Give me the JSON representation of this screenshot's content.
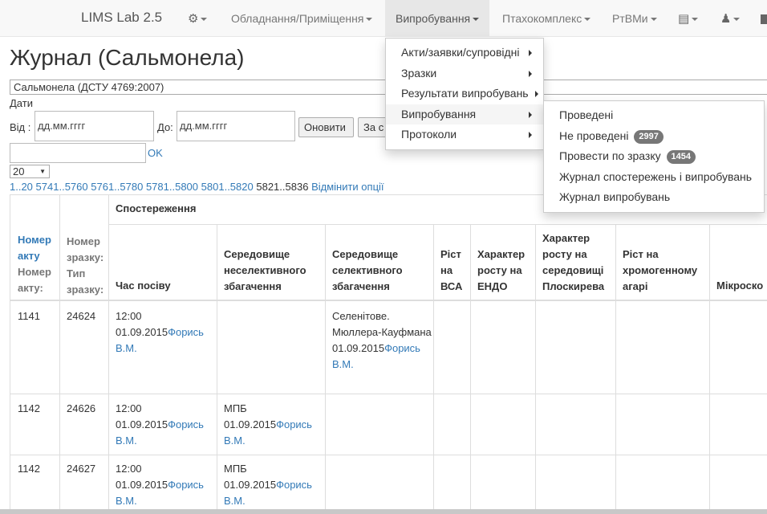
{
  "navbar": {
    "brand": "LIMS Lab 2.5",
    "settings_icon": "gear-icon",
    "menus": [
      {
        "label": "Обладнання/Приміщення"
      },
      {
        "label": "Випробування"
      },
      {
        "label": "Птахокомплекс"
      },
      {
        "label": "РтВМи"
      }
    ],
    "list_icon": "list-icon",
    "user_icon": "user-icon"
  },
  "page": {
    "title": "Журнал (Сальмонела)",
    "test_select": "Сальмонела (ДСТУ 4769:2007)",
    "dates_label": "Дати",
    "from_label": "Від :",
    "from_placeholder": "дд.мм.гггг",
    "to_label": "До:",
    "to_placeholder": "дд.мм.гггг",
    "refresh_button": "Оновити",
    "second_button": "За с",
    "ok_link": "OK",
    "per_page": "20"
  },
  "pager": {
    "links": [
      "1..20",
      "5741..5760",
      "5761..5780",
      "5781..5800",
      "5801..5820"
    ],
    "current": "5821..5836",
    "cancel_options": "Відмінити опції"
  },
  "table": {
    "col_act_link": "Номер акту",
    "col_act_sub": "Номер акту:",
    "col_sample": "Номер зразку:",
    "col_sample_type": "Тип зразку:",
    "group_header": "Спостереження",
    "columns": [
      "Час посіву",
      "Середовище неселективного збагачення",
      "Середовище селективного збагачення",
      "Ріст на ВСА",
      "Характер росту на ЕНДО",
      "Характер росту на середовищі Плоскирева",
      "Ріст на хромогенному агарі",
      "Мікроско"
    ],
    "rows": [
      {
        "act": "1141",
        "sample": "24624",
        "sow_time": "12:00",
        "sow_date": "01.09.2015",
        "sow_person": "Форись В.М.",
        "nonselective": "",
        "nonselective_date": "",
        "nonselective_person": "",
        "selective": "Селенітове. Мюллера-Кауфмана",
        "selective_date": "01.09.2015",
        "selective_person": "Форись В.М."
      },
      {
        "act": "1142",
        "sample": "24626",
        "sow_time": "12:00",
        "sow_date": "01.09.2015",
        "sow_person": "Форись В.М.",
        "nonselective": "МПБ",
        "nonselective_date": "01.09.2015",
        "nonselective_person": "Форись В.М.",
        "selective": "",
        "selective_date": "",
        "selective_person": ""
      },
      {
        "act": "1142",
        "sample": "24627",
        "sow_time": "12:00",
        "sow_date": "01.09.2015",
        "sow_person": "Форись В.М.",
        "nonselective": "МПБ",
        "nonselective_date": "01.09.2015",
        "nonselective_person": "Форись В.М.",
        "selective": "",
        "selective_date": "",
        "selective_person": ""
      }
    ]
  },
  "dropdown": {
    "items": [
      {
        "label": "Акти/заявки/супровідні"
      },
      {
        "label": "Зразки"
      },
      {
        "label": "Результати випробувань"
      },
      {
        "label": "Випробування"
      },
      {
        "label": "Протоколи"
      }
    ]
  },
  "submenu": {
    "items": [
      {
        "label": "Проведені",
        "badge": ""
      },
      {
        "label": "Не проведені",
        "badge": "2997"
      },
      {
        "label": "Провести по зразку",
        "badge": "1454"
      },
      {
        "label": "Журнал спостережень і випробувань",
        "badge": ""
      },
      {
        "label": "Журнал випробувань",
        "badge": ""
      }
    ]
  },
  "colors": {
    "link": "#337ab7",
    "navbar_bg": "#f8f8f8",
    "navbar_active": "#e7e7e7",
    "badge": "#777777",
    "border": "#dddddd"
  }
}
